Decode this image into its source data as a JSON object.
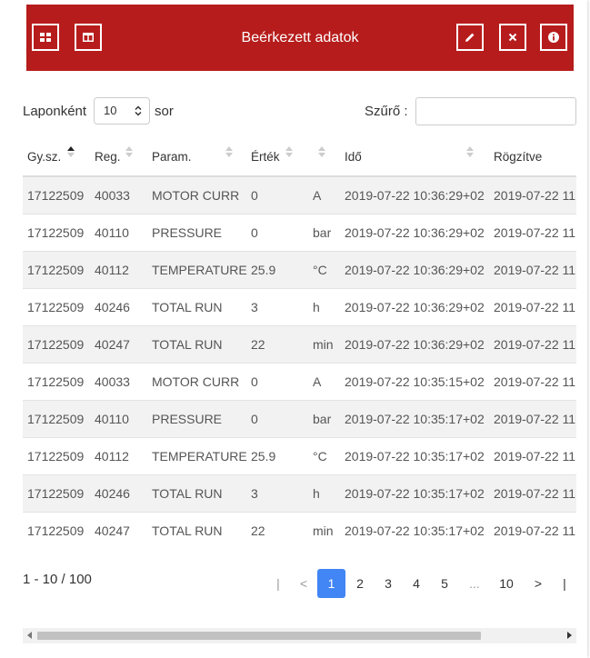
{
  "header": {
    "title": "Beérkezett adatok",
    "color": "#b71c1c"
  },
  "controls": {
    "per_page_label": "Laponként",
    "per_page_value": "10",
    "rows_label": "sor",
    "filter_label": "Szűrő :",
    "filter_value": ""
  },
  "table": {
    "columns": [
      "Gy.sz.",
      "Reg.",
      "Param.",
      "Érték",
      "",
      "Idő",
      "Rögzítve"
    ],
    "rows": [
      [
        "17122509",
        "40033",
        "MOTOR CURR",
        "0",
        "A",
        "2019-07-22 10:36:29+02",
        "2019-07-22 11"
      ],
      [
        "17122509",
        "40110",
        "PRESSURE",
        "0",
        "bar",
        "2019-07-22 10:36:29+02",
        "2019-07-22 11"
      ],
      [
        "17122509",
        "40112",
        "TEMPERATURE",
        "25.9",
        "°C",
        "2019-07-22 10:36:29+02",
        "2019-07-22 11"
      ],
      [
        "17122509",
        "40246",
        "TOTAL RUN",
        "3",
        "h",
        "2019-07-22 10:36:29+02",
        "2019-07-22 11"
      ],
      [
        "17122509",
        "40247",
        "TOTAL RUN",
        "22",
        "min",
        "2019-07-22 10:36:29+02",
        "2019-07-22 11"
      ],
      [
        "17122509",
        "40033",
        "MOTOR CURR",
        "0",
        "A",
        "2019-07-22 10:35:15+02",
        "2019-07-22 11"
      ],
      [
        "17122509",
        "40110",
        "PRESSURE",
        "0",
        "bar",
        "2019-07-22 10:35:17+02",
        "2019-07-22 11"
      ],
      [
        "17122509",
        "40112",
        "TEMPERATURE",
        "25.9",
        "°C",
        "2019-07-22 10:35:17+02",
        "2019-07-22 11"
      ],
      [
        "17122509",
        "40246",
        "TOTAL RUN",
        "3",
        "h",
        "2019-07-22 10:35:17+02",
        "2019-07-22 11"
      ],
      [
        "17122509",
        "40247",
        "TOTAL RUN",
        "22",
        "min",
        "2019-07-22 10:35:17+02",
        "2019-07-22 11"
      ]
    ]
  },
  "pagination": {
    "info": "1 - 10 / 100",
    "first": "|",
    "prev": "<",
    "pages": [
      "1",
      "2",
      "3",
      "4",
      "5"
    ],
    "ellipsis": "...",
    "last_page": "10",
    "next": ">",
    "last": "|",
    "active_color": "#4285f4"
  }
}
